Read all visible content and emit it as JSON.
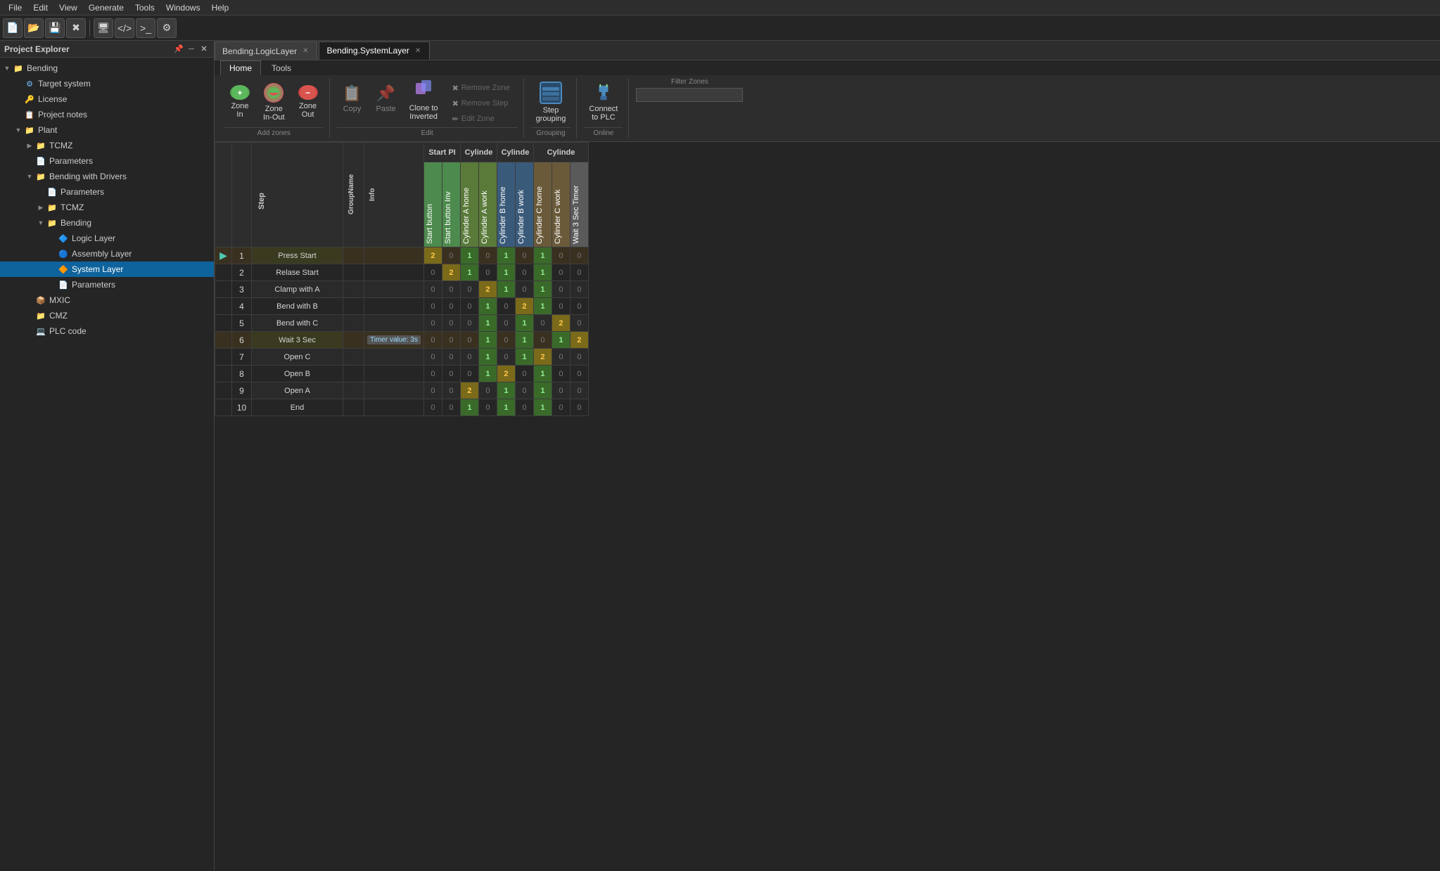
{
  "app": {
    "menu": [
      "File",
      "Edit",
      "View",
      "Generate",
      "Tools",
      "Windows",
      "Help"
    ]
  },
  "project_explorer": {
    "title": "Project Explorer",
    "tree": [
      {
        "id": "bending",
        "label": "Bending",
        "level": 0,
        "icon": "folder",
        "expanded": true
      },
      {
        "id": "target-system",
        "label": "Target system",
        "level": 1,
        "icon": "gear"
      },
      {
        "id": "license",
        "label": "License",
        "level": 1,
        "icon": "license"
      },
      {
        "id": "project-notes",
        "label": "Project notes",
        "level": 1,
        "icon": "doc"
      },
      {
        "id": "plant",
        "label": "Plant",
        "level": 1,
        "icon": "folder",
        "expanded": true
      },
      {
        "id": "tcmz",
        "label": "TCMZ",
        "level": 2,
        "icon": "folder",
        "expandable": true
      },
      {
        "id": "parameters-plant",
        "label": "Parameters",
        "level": 2,
        "icon": "param"
      },
      {
        "id": "bending-with-drivers",
        "label": "Bending with Drivers",
        "level": 2,
        "icon": "folder",
        "expanded": true
      },
      {
        "id": "parameters-bwd",
        "label": "Parameters",
        "level": 3,
        "icon": "param"
      },
      {
        "id": "tcmz-bwd",
        "label": "TCMZ",
        "level": 3,
        "icon": "folder",
        "expandable": true
      },
      {
        "id": "bending-node",
        "label": "Bending",
        "level": 3,
        "icon": "folder",
        "expanded": true
      },
      {
        "id": "logic-layer",
        "label": "Logic Layer",
        "level": 4,
        "icon": "logic"
      },
      {
        "id": "assembly-layer",
        "label": "Assembly Layer",
        "level": 4,
        "icon": "assembly"
      },
      {
        "id": "system-layer",
        "label": "System Layer",
        "level": 4,
        "icon": "system",
        "active": true
      },
      {
        "id": "parameters-bending",
        "label": "Parameters",
        "level": 4,
        "icon": "param"
      },
      {
        "id": "mxic",
        "label": "MXIC",
        "level": 2,
        "icon": "mxic"
      },
      {
        "id": "cmz",
        "label": "CMZ",
        "level": 2,
        "icon": "cmz"
      },
      {
        "id": "plc-code",
        "label": "PLC code",
        "level": 2,
        "icon": "plc"
      }
    ]
  },
  "tabs": [
    {
      "id": "logic-layer-tab",
      "label": "Bending.LogicLayer",
      "closeable": true,
      "active": false
    },
    {
      "id": "system-layer-tab",
      "label": "Bending.SystemLayer",
      "closeable": true,
      "active": true
    }
  ],
  "ribbon": {
    "tabs": [
      {
        "id": "home-tab",
        "label": "Home",
        "active": true
      },
      {
        "id": "tools-tab",
        "label": "Tools",
        "active": false
      }
    ],
    "groups": {
      "add_zones": {
        "label": "Add zones",
        "buttons": [
          {
            "id": "zone-in",
            "label": "Zone\nIn",
            "icon": "zone-in"
          },
          {
            "id": "zone-in-out",
            "label": "Zone\nIn-Out",
            "icon": "zone-in-out"
          },
          {
            "id": "zone-out",
            "label": "Zone\nOut",
            "icon": "zone-out"
          }
        ]
      },
      "edit": {
        "label": "Edit",
        "buttons_main": [
          {
            "id": "copy",
            "label": "Copy",
            "icon": "copy"
          },
          {
            "id": "paste",
            "label": "Paste",
            "icon": "paste"
          },
          {
            "id": "clone-to-inverted",
            "label": "Clone to\nInverted",
            "icon": "clone"
          }
        ],
        "buttons_small": [
          {
            "id": "remove-zone",
            "label": "Remove Zone",
            "icon": "remove"
          },
          {
            "id": "remove-step",
            "label": "Remove Step",
            "icon": "remove"
          },
          {
            "id": "edit-zone",
            "label": "Edit Zone",
            "icon": "edit"
          }
        ]
      },
      "grouping": {
        "label": "Grouping",
        "buttons": [
          {
            "id": "step-grouping",
            "label": "Step\ngrouping",
            "icon": "step-group"
          }
        ]
      },
      "online": {
        "label": "Online",
        "buttons": [
          {
            "id": "connect-to-plc",
            "label": "Connect\nto PLC",
            "icon": "connect"
          }
        ]
      },
      "filter": {
        "label": "Filter",
        "label_text": "Filter Zones",
        "input_placeholder": ""
      }
    }
  },
  "table": {
    "top_headers": [
      {
        "id": "start-pi",
        "label": "Start PI",
        "colspan": 2
      },
      {
        "id": "cylinder-a",
        "label": "Cylinde",
        "colspan": 2
      },
      {
        "id": "cylinder-b",
        "label": "Cylinde",
        "colspan": 2
      },
      {
        "id": "cylinder-c",
        "label": "Cylinde",
        "colspan": 3
      }
    ],
    "col_headers": [
      "Start button",
      "Start button Inv",
      "Cylinder A home",
      "Cylinder A work",
      "Cylinder B home",
      "Cylinder B work",
      "Cylinder C home",
      "Cylinder C work",
      "Wait 3 Sec Timer"
    ],
    "col_header_colors": [
      "#4d8a4d",
      "#4d8a4d",
      "#5a7a3a",
      "#5a7a3a",
      "#3a5a7a",
      "#3a5a7a",
      "#6a5a3a",
      "#6a5a3a",
      "#5a5a5a"
    ],
    "rows": [
      {
        "num": 1,
        "active": true,
        "name": "Press Start",
        "group": "",
        "info": "",
        "values": [
          2,
          0,
          1,
          0,
          1,
          0,
          1,
          0,
          0
        ]
      },
      {
        "num": 2,
        "active": false,
        "name": "Relase Start",
        "group": "",
        "info": "",
        "values": [
          0,
          2,
          1,
          0,
          1,
          0,
          1,
          0,
          0
        ]
      },
      {
        "num": 3,
        "active": false,
        "name": "Clamp with A",
        "group": "",
        "info": "",
        "values": [
          0,
          0,
          0,
          2,
          1,
          0,
          1,
          0,
          0
        ]
      },
      {
        "num": 4,
        "active": false,
        "name": "Bend with B",
        "group": "",
        "info": "",
        "values": [
          0,
          0,
          0,
          1,
          0,
          2,
          1,
          0,
          0
        ]
      },
      {
        "num": 5,
        "active": false,
        "name": "Bend with C",
        "group": "",
        "info": "",
        "values": [
          0,
          0,
          0,
          1,
          0,
          1,
          0,
          2,
          0
        ]
      },
      {
        "num": 6,
        "active": true,
        "name": "Wait 3 Sec",
        "group": "",
        "info": "Timer value: 3s",
        "values": [
          0,
          0,
          0,
          1,
          0,
          1,
          0,
          1,
          2
        ]
      },
      {
        "num": 7,
        "active": false,
        "name": "Open C",
        "group": "",
        "info": "",
        "values": [
          0,
          0,
          0,
          1,
          0,
          1,
          2,
          0,
          0
        ]
      },
      {
        "num": 8,
        "active": false,
        "name": "Open B",
        "group": "",
        "info": "",
        "values": [
          0,
          0,
          0,
          1,
          2,
          0,
          1,
          0,
          0
        ]
      },
      {
        "num": 9,
        "active": false,
        "name": "Open A",
        "group": "",
        "info": "",
        "values": [
          0,
          0,
          2,
          0,
          1,
          0,
          1,
          0,
          0
        ]
      },
      {
        "num": 10,
        "active": false,
        "name": "End",
        "group": "",
        "info": "",
        "values": [
          0,
          0,
          1,
          0,
          1,
          0,
          1,
          0,
          0
        ]
      }
    ]
  }
}
